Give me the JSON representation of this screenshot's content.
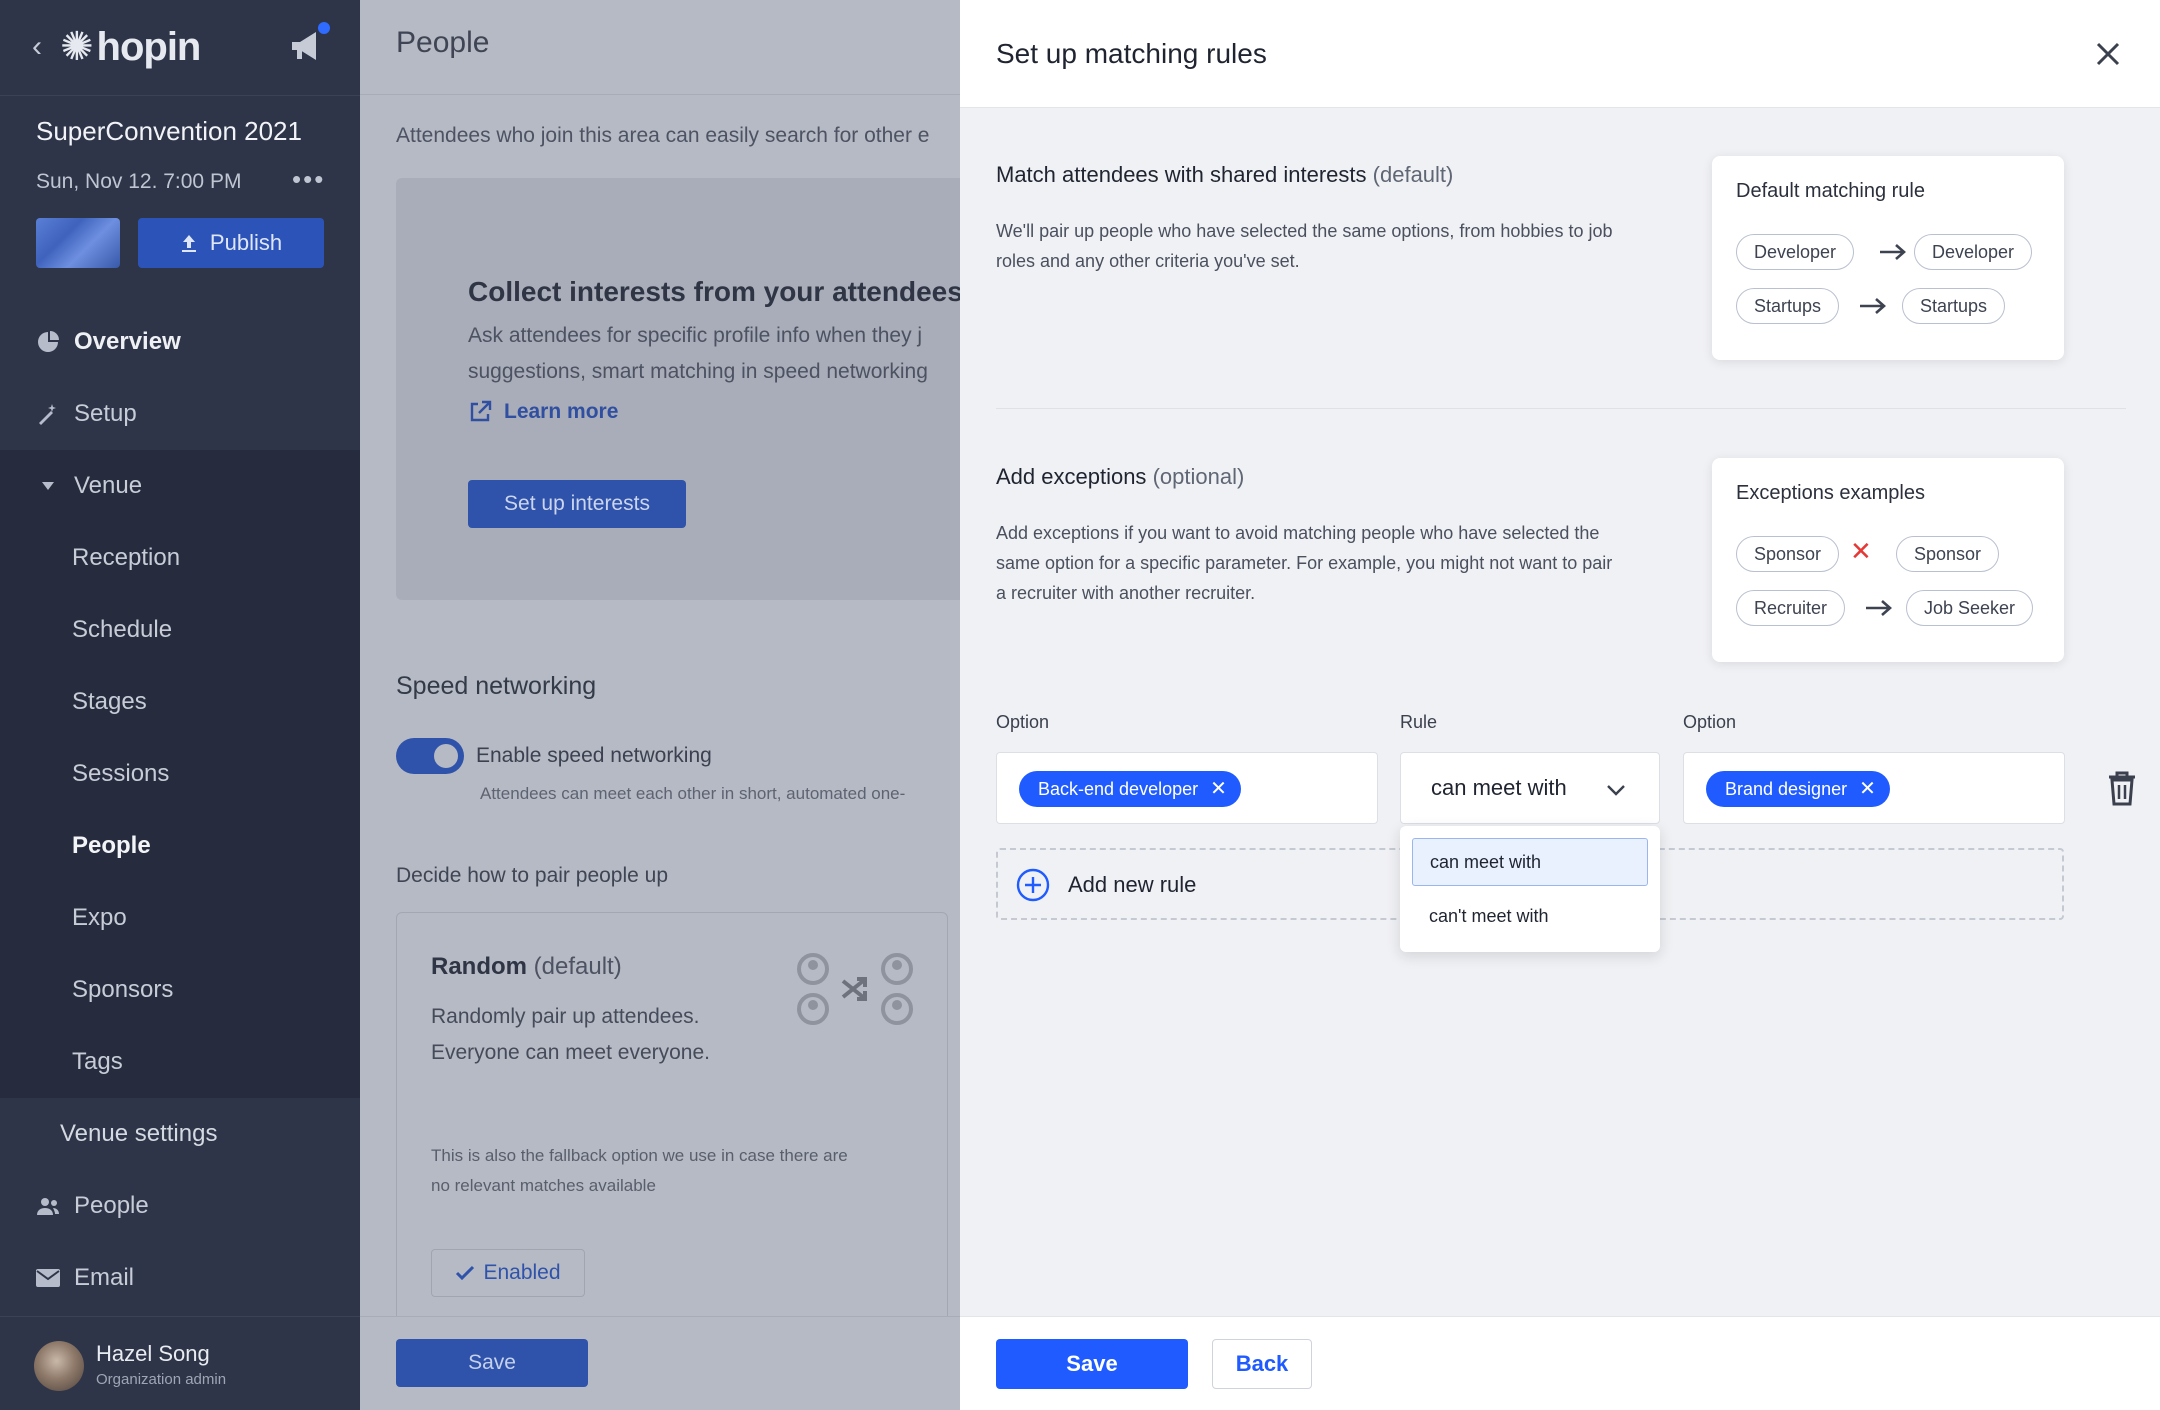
{
  "sidebar": {
    "logo": "hopin",
    "event_name": "SuperConvention 2021",
    "event_date": "Sun, Nov 12. 7:00 PM",
    "more": "•••",
    "publish_label": "Publish",
    "nav": {
      "overview": "Overview",
      "setup": "Setup",
      "venue": "Venue",
      "reception": "Reception",
      "schedule": "Schedule",
      "stages": "Stages",
      "sessions": "Sessions",
      "people_sub": "People",
      "expo": "Expo",
      "sponsors": "Sponsors",
      "tags": "Tags",
      "venue_settings": "Venue settings",
      "people": "People",
      "email": "Email"
    },
    "user": {
      "name": "Hazel Song",
      "role": "Organization admin"
    }
  },
  "main": {
    "title": "People",
    "description": "Attendees who join this area can easily search for other e",
    "collect": {
      "title": "Collect interests from your attendees",
      "text_line1": "Ask attendees for specific profile info when they j",
      "text_line2": "suggestions, smart matching in speed networking",
      "learn_more": "Learn more",
      "setup_button": "Set up interests"
    },
    "speed": {
      "title": "Speed networking",
      "toggle_label": "Enable speed networking",
      "toggle_sub": "Attendees can meet each other in short, automated one-"
    },
    "decide": "Decide how to pair people up",
    "random": {
      "title": "Random",
      "default_tag": "(default)",
      "line1": "Randomly pair up attendees.",
      "line2": "Everyone can meet everyone.",
      "note_line1": "This is also the fallback option we use in case there are",
      "note_line2": "no relevant matches available",
      "enabled": "Enabled"
    },
    "save": "Save"
  },
  "drawer": {
    "title": "Set up matching rules",
    "shared": {
      "title": "Match attendees with shared interests",
      "tag": "(default)",
      "line1": "We'll pair up people who have selected the same options, from hobbies to job",
      "line2": "roles and any other criteria you've set.",
      "card_title": "Default matching rule",
      "rows": [
        {
          "left": "Developer",
          "right": "Developer"
        },
        {
          "left": "Startups",
          "right": "Startups"
        }
      ]
    },
    "exceptions": {
      "title": "Add exceptions",
      "tag": "(optional)",
      "line1": "Add exceptions if you want to avoid matching people who have selected the",
      "line2": "same option for a specific parameter. For example, you might not want to pair",
      "line3": "a recruiter with another recruiter.",
      "card_title": "Exceptions examples",
      "rows": [
        {
          "left": "Sponsor",
          "right": "Sponsor",
          "relation": "cannot"
        },
        {
          "left": "Recruiter",
          "right": "Job Seeker",
          "relation": "can"
        }
      ]
    },
    "rule_editor": {
      "option_label_1": "Option",
      "rule_label": "Rule",
      "option_label_2": "Option",
      "option_1_value": "Back-end developer",
      "rule_value": "can meet with",
      "option_2_value": "Brand designer",
      "dropdown_options": [
        "can meet with",
        "can't meet with"
      ],
      "add_rule": "Add new rule"
    },
    "footer": {
      "save": "Save",
      "back": "Back"
    }
  },
  "colors": {
    "accent": "#1f5bff",
    "sidebar_bg": "#2e3548",
    "danger": "#e53935"
  }
}
